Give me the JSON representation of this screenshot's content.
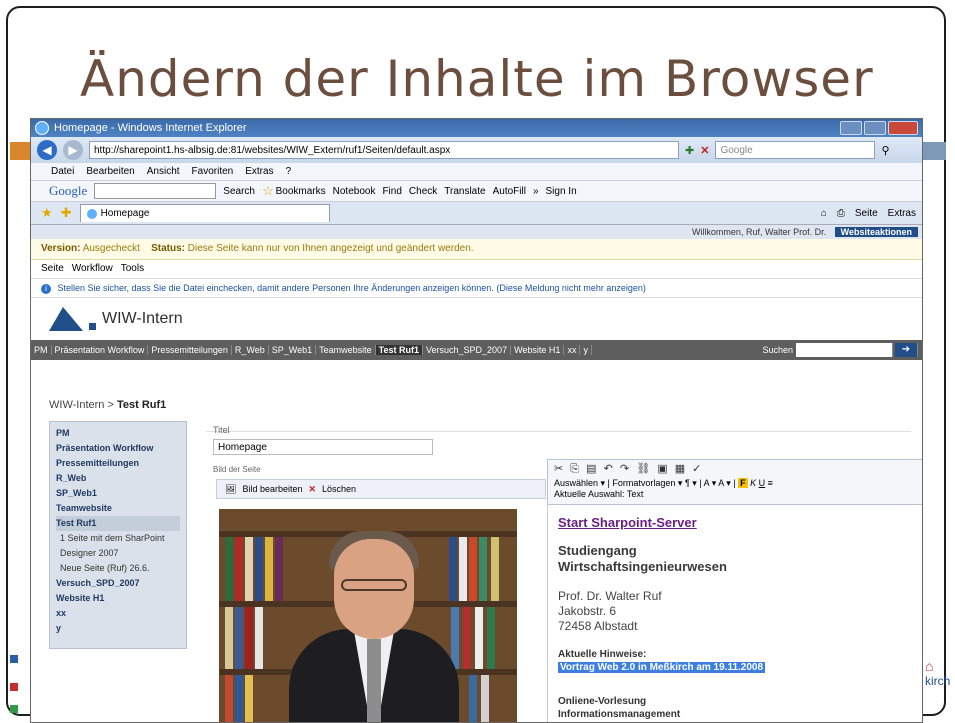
{
  "slide": {
    "title": "Ändern der Inhalte im Browser",
    "accent_color": "#7d99b5",
    "title_color": "#6b4e3d",
    "footer_logo_text": "kirch"
  },
  "browser": {
    "window_title": "Homepage - Windows Internet Explorer",
    "url": "http://sharepoint1.hs-albsig.de:81/websites/WIW_Extern/ruf1/Seiten/default.aspx",
    "search_placeholder": "Google",
    "menu": [
      "Datei",
      "Bearbeiten",
      "Ansicht",
      "Favoriten",
      "Extras",
      "?"
    ],
    "google_toolbar": {
      "logo": "Google",
      "items": [
        "Search",
        "Bookmarks",
        "Notebook",
        "Find",
        "Check",
        "Translate",
        "AutoFill",
        "»",
        "Sign In"
      ]
    },
    "tab_label": "Homepage",
    "tab_tools": [
      "Seite",
      "Extras"
    ]
  },
  "sharepoint": {
    "welcome": "Willkommen, Ruf, Walter Prof. Dr.",
    "site_actions": "Websiteaktionen",
    "status": {
      "version_label": "Version:",
      "version_value": "Ausgecheckt",
      "status_label": "Status:",
      "status_value": "Diese Seite kann nur von Ihnen angezeigt und geändert werden."
    },
    "page_menu": [
      "Seite",
      "Workflow",
      "Tools"
    ],
    "info_message": "Stellen Sie sicher, dass Sie die Datei einchecken, damit andere Personen Ihre Änderungen anzeigen können.",
    "info_dismiss": "(Diese Meldung nicht mehr anzeigen)",
    "site_name": "WIW-Intern",
    "topnav": [
      "PM",
      "Präsentation Workflow",
      "Pressemitteilungen",
      "R_Web",
      "SP_Web1",
      "Teamwebsite",
      "Test Ruf1",
      "Versuch_SPD_2007",
      "Website H1",
      "xx",
      "y"
    ],
    "topnav_active": "Test Ruf1",
    "search_label": "Suchen",
    "breadcrumb_root": "WIW-Intern",
    "breadcrumb_sep": ">",
    "breadcrumb_current": "Test Ruf1",
    "quicklaunch": [
      {
        "label": "PM",
        "type": "item"
      },
      {
        "label": "Präsentation Workflow",
        "type": "item"
      },
      {
        "label": "Pressemitteilungen",
        "type": "item"
      },
      {
        "label": "R_Web",
        "type": "item"
      },
      {
        "label": "SP_Web1",
        "type": "item"
      },
      {
        "label": "Teamwebsite",
        "type": "item"
      },
      {
        "label": "Test Ruf1",
        "type": "item"
      },
      {
        "label": "1 Seite mit dem SharPoint",
        "type": "sub"
      },
      {
        "label": "Designer 2007",
        "type": "sub"
      },
      {
        "label": "Neue Seite (Ruf) 26.6.",
        "type": "sub"
      },
      {
        "label": "Versuch_SPD_2007",
        "type": "item"
      },
      {
        "label": "Website H1",
        "type": "item"
      },
      {
        "label": "xx",
        "type": "item"
      },
      {
        "label": "y",
        "type": "item"
      }
    ],
    "title_field_label": "Titel",
    "title_field_value": "Homepage",
    "picture_label": "Bild der Seite",
    "picture_edit": "Bild bearbeiten",
    "picture_delete": "Löschen"
  },
  "editor": {
    "toolbar_select": "Auswählen",
    "toolbar_styles": "Formatvorlagen",
    "current_selection": "Aktuelle Auswahl: Text",
    "link": "Start Sharpoint-Server",
    "heading_line1": "Studiengang",
    "heading_line2": "Wirtschaftsingenieurwesen",
    "address_line1": "Prof. Dr. Walter Ruf",
    "address_line2": "Jakobstr. 6",
    "address_line3": "72458 Albstadt",
    "hinweise_label": "Aktuelle Hinweise:",
    "hinweise_text": "Vortrag Web 2.0 in Meßkirch am 19.11.2008",
    "onliene_line1": "Onliene-Vorlesung",
    "onliene_line2": "Informationsmanagement"
  }
}
